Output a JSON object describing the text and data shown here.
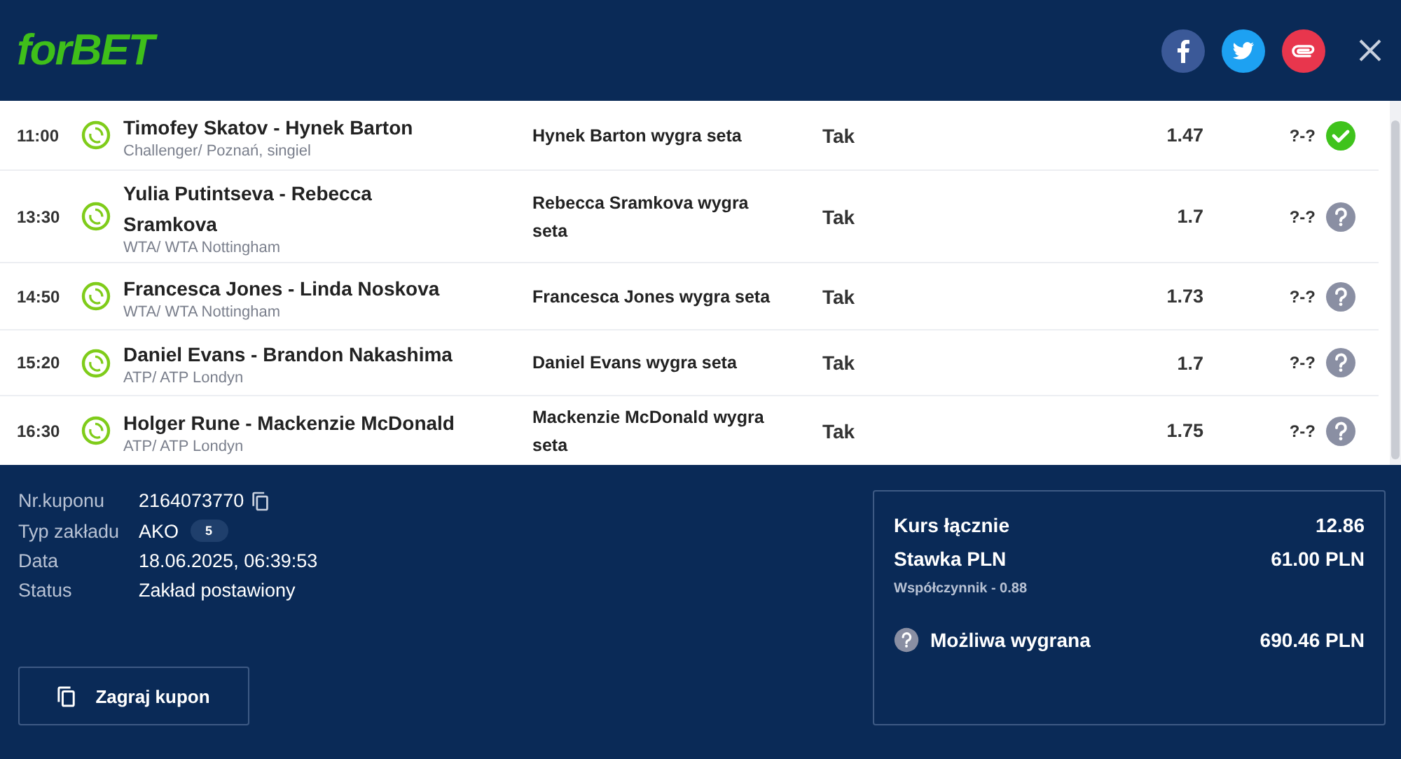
{
  "header": {
    "logo": "forBET",
    "share": [
      {
        "kind": "facebook"
      },
      {
        "kind": "twitter"
      },
      {
        "kind": "link"
      }
    ]
  },
  "bets": [
    {
      "time": "11:00",
      "match": "Timofey Skatov - Hynek Barton",
      "league": "Challenger/ Poznań, singiel",
      "pick": "Hynek Barton wygra seta",
      "answer": "Tak",
      "odds": "1.47",
      "score": "?-?",
      "kind": "won"
    },
    {
      "time": "13:30",
      "match": "Yulia Putintseva - Rebecca Sramkova",
      "league": "WTA/ WTA Nottingham",
      "pick": "Rebecca Sramkova wygra seta",
      "answer": "Tak",
      "odds": "1.7",
      "score": "?-?",
      "kind": "pending"
    },
    {
      "time": "14:50",
      "match": "Francesca Jones - Linda Noskova",
      "league": "WTA/ WTA Nottingham",
      "pick": "Francesca Jones wygra seta",
      "answer": "Tak",
      "odds": "1.73",
      "score": "?-?",
      "kind": "pending"
    },
    {
      "time": "15:20",
      "match": "Daniel Evans - Brandon Nakashima",
      "league": "ATP/ ATP Londyn",
      "pick": "Daniel Evans wygra seta",
      "answer": "Tak",
      "odds": "1.7",
      "score": "?-?",
      "kind": "pending"
    },
    {
      "time": "16:30",
      "match": "Holger Rune - Mackenzie McDonald",
      "league": "ATP/ ATP Londyn",
      "pick": "Mackenzie McDonald wygra seta",
      "answer": "Tak",
      "odds": "1.75",
      "score": "?-?",
      "kind": "pending"
    }
  ],
  "coupon": {
    "details": [
      {
        "label": "Nr.kuponu",
        "value": "2164073770",
        "kind": "copy"
      },
      {
        "label": "Typ zakładu",
        "value": "AKO",
        "badge": "5",
        "kind": "badge"
      },
      {
        "label": "Data",
        "value": "18.06.2025, 06:39:53",
        "kind": "plain"
      },
      {
        "label": "Status",
        "value": "Zakład postawiony",
        "kind": "plain"
      }
    ],
    "replay_button": "Zagraj kupon"
  },
  "summary": {
    "total_odds_label": "Kurs łącznie",
    "total_odds": "12.86",
    "stake_label": "Stawka PLN",
    "stake": "61.00 PLN",
    "factor": "Współczynnik - 0.88",
    "win_label": "Możliwa wygrana",
    "win": "690.46 PLN"
  }
}
